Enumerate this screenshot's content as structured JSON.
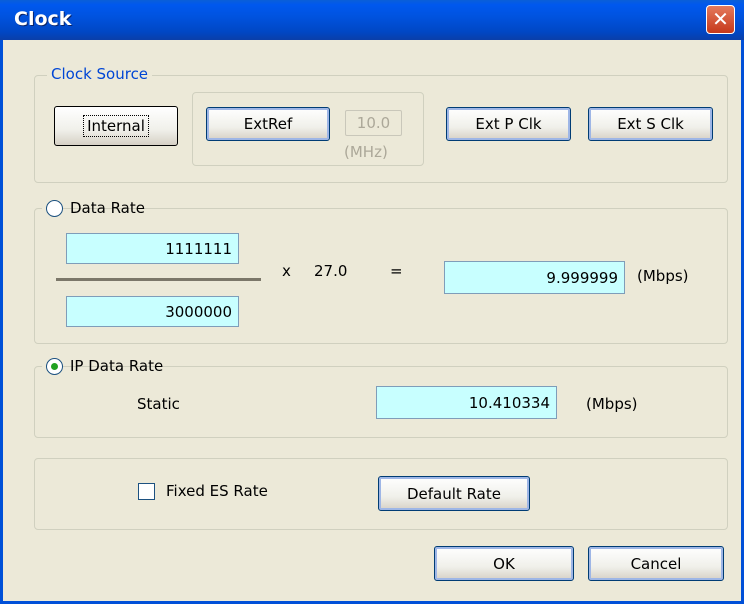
{
  "window": {
    "title": "Clock",
    "close_glyph": "✕"
  },
  "clock_source": {
    "legend": "Clock Source",
    "internal_label": "Internal",
    "extref_label": "ExtRef",
    "extref_value": "10.0",
    "extref_unit": "(MHz)",
    "ext_p_clk_label": "Ext P Clk",
    "ext_s_clk_label": "Ext S Clk"
  },
  "data_rate": {
    "label": "Data Rate",
    "selected": false,
    "numerator": "1111111",
    "denominator": "3000000",
    "multiply_sign": "x",
    "multiplier": "27.0",
    "equals_sign": "=",
    "result": "9.999999",
    "unit": "(Mbps)"
  },
  "ip_data_rate": {
    "label": "IP Data Rate",
    "selected": true,
    "mode": "Static",
    "value": "10.410334",
    "unit": "(Mbps)"
  },
  "options": {
    "fixed_es_rate_label": "Fixed ES Rate",
    "fixed_es_rate_checked": false,
    "default_rate_label": "Default Rate"
  },
  "footer": {
    "ok_label": "OK",
    "cancel_label": "Cancel"
  },
  "colors": {
    "titlebar": "#0053e0",
    "field_bg": "#c8ffff",
    "group_legend": "#0046d5",
    "dialog_bg": "#ece9d8"
  }
}
